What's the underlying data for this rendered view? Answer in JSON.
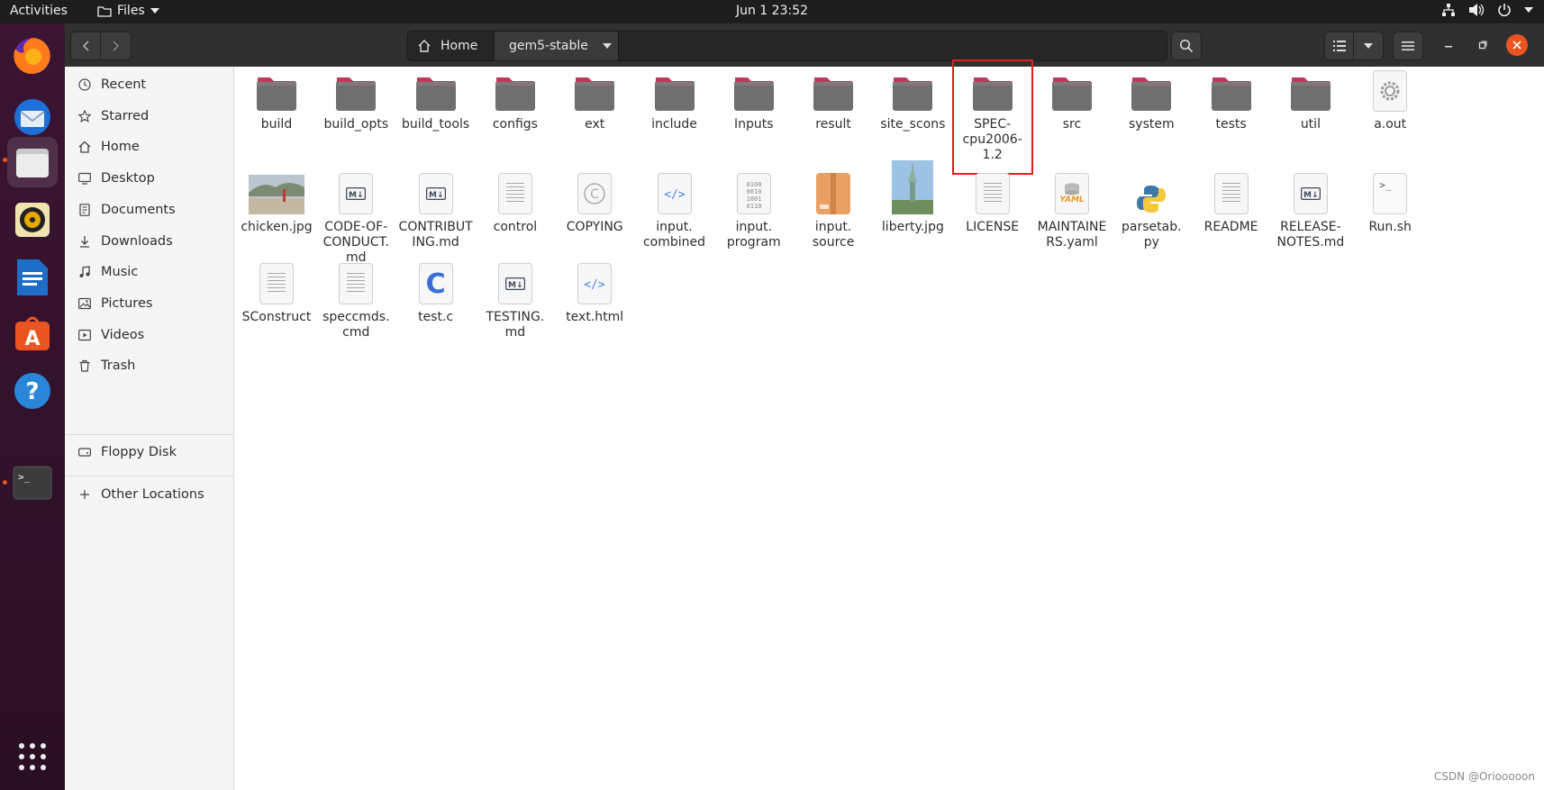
{
  "topbar": {
    "activities": "Activities",
    "app_menu": "Files",
    "clock": "Jun 1  23:52"
  },
  "dock": {
    "items": [
      "firefox-icon",
      "thunderbird-icon",
      "files-icon",
      "rhythmbox-icon",
      "writer-icon",
      "software-icon",
      "help-icon",
      "terminal-icon",
      "app-grid-icon"
    ]
  },
  "header": {
    "path": {
      "home_label": "Home",
      "current_label": "gem5-stable"
    }
  },
  "sidebar": {
    "items": [
      {
        "label": "Recent",
        "icon": "clock-icon"
      },
      {
        "label": "Starred",
        "icon": "star-icon"
      },
      {
        "label": "Home",
        "icon": "home-icon"
      },
      {
        "label": "Desktop",
        "icon": "desktop-icon"
      },
      {
        "label": "Documents",
        "icon": "documents-icon"
      },
      {
        "label": "Downloads",
        "icon": "download-icon"
      },
      {
        "label": "Music",
        "icon": "music-icon"
      },
      {
        "label": "Pictures",
        "icon": "pictures-icon"
      },
      {
        "label": "Videos",
        "icon": "videos-icon"
      },
      {
        "label": "Trash",
        "icon": "trash-icon"
      }
    ],
    "devices": [
      {
        "label": "Floppy Disk",
        "icon": "drive-icon"
      }
    ],
    "other": {
      "label": "Other Locations",
      "icon": "plus-icon"
    }
  },
  "files": [
    {
      "name": "build",
      "type": "folder"
    },
    {
      "name": "build_opts",
      "type": "folder"
    },
    {
      "name": "build_tools",
      "type": "folder"
    },
    {
      "name": "configs",
      "type": "folder"
    },
    {
      "name": "ext",
      "type": "folder"
    },
    {
      "name": "include",
      "type": "folder"
    },
    {
      "name": "Inputs",
      "type": "folder"
    },
    {
      "name": "result",
      "type": "folder"
    },
    {
      "name": "site_scons",
      "type": "folder"
    },
    {
      "name": "SPEC-cpu2006-1.2",
      "type": "folder",
      "highlighted": true
    },
    {
      "name": "src",
      "type": "folder"
    },
    {
      "name": "system",
      "type": "folder"
    },
    {
      "name": "tests",
      "type": "folder"
    },
    {
      "name": "util",
      "type": "folder"
    },
    {
      "name": "a.out",
      "type": "executable"
    },
    {
      "name": "chicken.jpg",
      "type": "image"
    },
    {
      "name": "CODE-OF-CONDUCT.md",
      "type": "markdown"
    },
    {
      "name": "CONTRIBUTING.md",
      "type": "markdown"
    },
    {
      "name": "control",
      "type": "text"
    },
    {
      "name": "COPYING",
      "type": "copyright"
    },
    {
      "name": "input.combined",
      "type": "html"
    },
    {
      "name": "input.program",
      "type": "binary"
    },
    {
      "name": "input.source",
      "type": "archive"
    },
    {
      "name": "liberty.jpg",
      "type": "image"
    },
    {
      "name": "LICENSE",
      "type": "text"
    },
    {
      "name": "MAINTAINERS.yaml",
      "type": "yaml"
    },
    {
      "name": "parsetab.py",
      "type": "python"
    },
    {
      "name": "README",
      "type": "text"
    },
    {
      "name": "RELEASE-NOTES.md",
      "type": "markdown"
    },
    {
      "name": "Run.sh",
      "type": "script"
    },
    {
      "name": "SConstruct",
      "type": "text"
    },
    {
      "name": "speccmds.cmd",
      "type": "text"
    },
    {
      "name": "test.c",
      "type": "c"
    },
    {
      "name": "TESTING.md",
      "type": "markdown"
    },
    {
      "name": "text.html",
      "type": "html"
    }
  ],
  "file_labels": [
    "build",
    "build_opts",
    "build_tools",
    "configs",
    "ext",
    "include",
    "Inputs",
    "result",
    "site_scons",
    "SPEC-\ncpu2006-\n1.2",
    "src",
    "system",
    "tests",
    "util",
    "a.out",
    "chicken.jpg",
    "CODE-OF-\nCONDUCT.\nmd",
    "CONTRIBUT\nING.md",
    "control",
    "COPYING",
    "input.\ncombined",
    "input.\nprogram",
    "input.\nsource",
    "liberty.jpg",
    "LICENSE",
    "MAINTAINE\nRS.yaml",
    "parsetab.\npy",
    "README",
    "RELEASE-\nNOTES.md",
    "Run.sh",
    "SConstruct",
    "speccmds.\ncmd",
    "test.c",
    "TESTING.\nmd",
    "text.html"
  ],
  "watermark": "CSDN @Oriooooon",
  "colors": {
    "accent": "#e95420",
    "folder": "#6f6f6f",
    "folder_tab": "#c0395d",
    "highlight_box": "#e02020"
  }
}
